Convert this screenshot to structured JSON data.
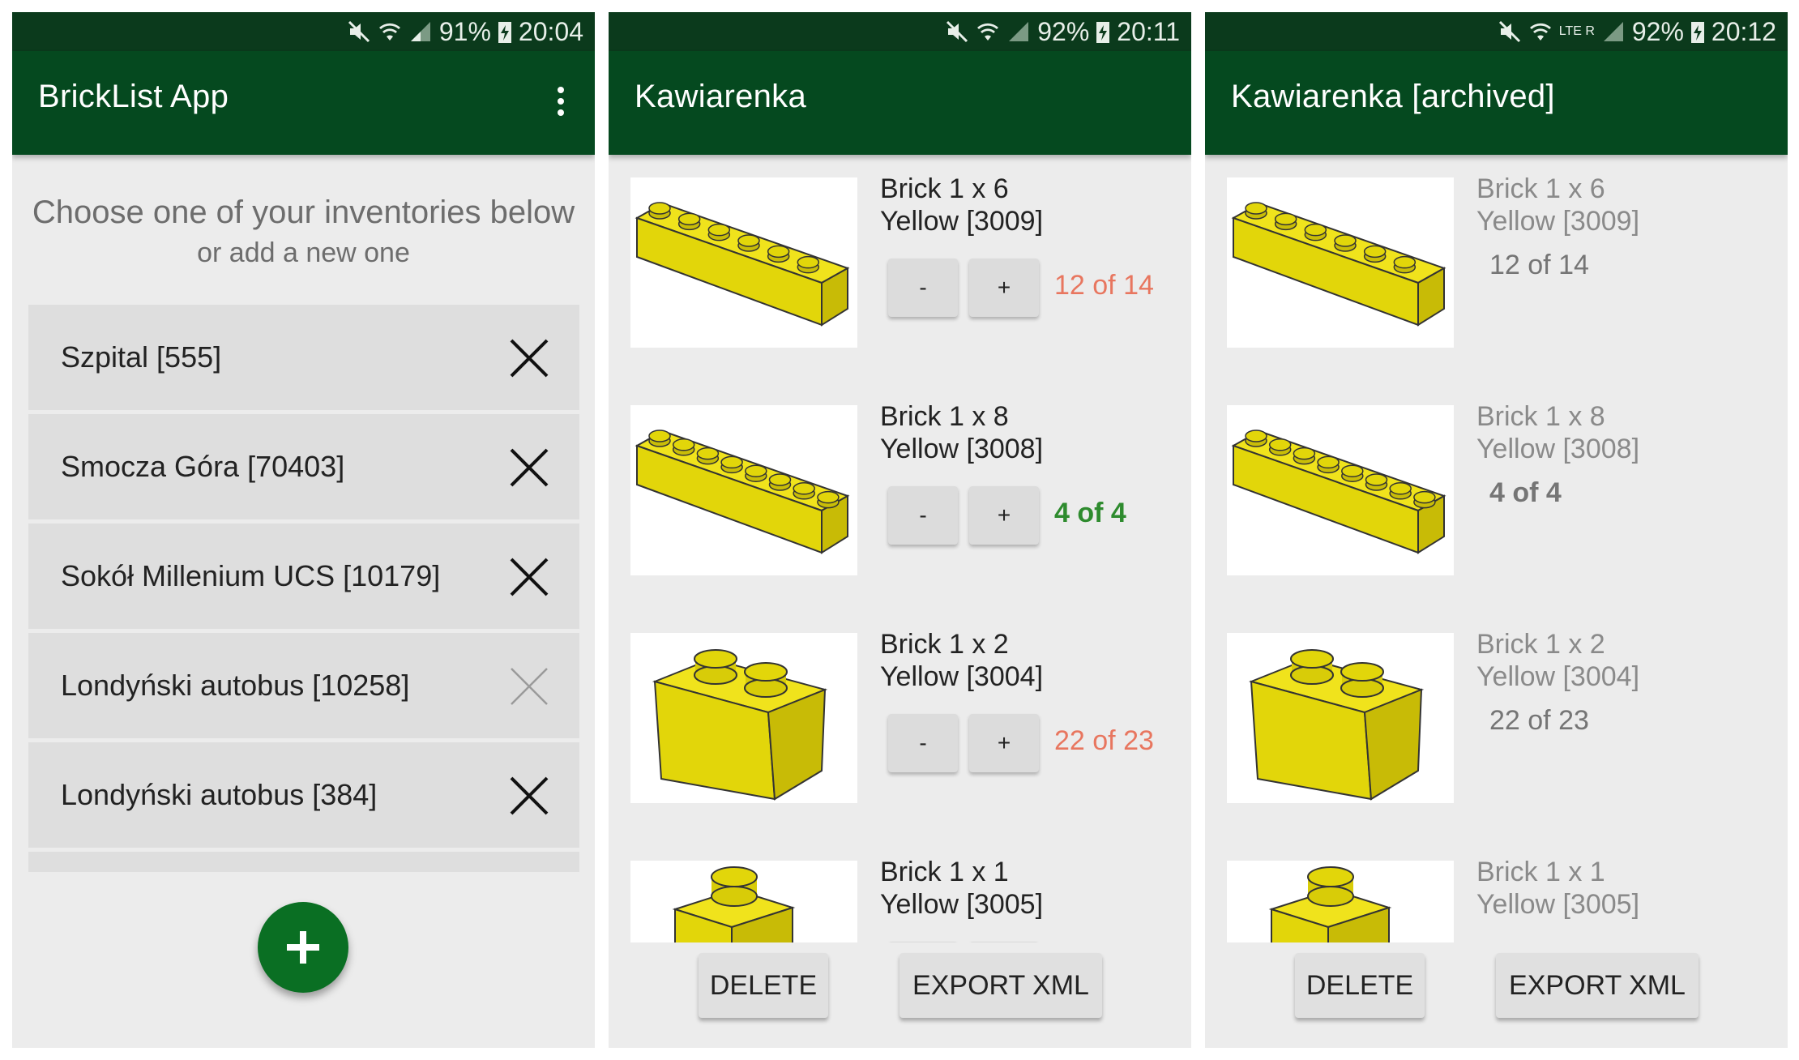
{
  "panel1": {
    "status": {
      "battery": "91%",
      "time": "20:04"
    },
    "title": "BrickList App",
    "menu_icon": "overflow-menu-icon",
    "choose_text": "Choose one of your inventories below",
    "choose_sub": "or add a new one",
    "inventories": [
      {
        "label": "Szpital [555]",
        "archived": false
      },
      {
        "label": "Smocza Góra [70403]",
        "archived": false
      },
      {
        "label": "Sokół Millenium UCS [10179]",
        "archived": false
      },
      {
        "label": "Londyński autobus [10258]",
        "archived": true
      },
      {
        "label": "Londyński autobus [384]",
        "archived": false
      }
    ],
    "fab_icon": "add-icon"
  },
  "panel2": {
    "status": {
      "battery": "92%",
      "time": "20:11"
    },
    "title": "Kawiarenka",
    "bricks": [
      {
        "name": "Brick 1 x 6",
        "color": "Yellow [3009]",
        "count": "12 of 14",
        "state": "incomplete",
        "shape": "1x6"
      },
      {
        "name": "Brick 1 x 8",
        "color": "Yellow [3008]",
        "count": "4 of 4",
        "state": "complete",
        "shape": "1x8"
      },
      {
        "name": "Brick 1 x 2",
        "color": "Yellow [3004]",
        "count": "22 of 23",
        "state": "incomplete",
        "shape": "1x2"
      },
      {
        "name": "Brick 1 x 1",
        "color": "Yellow [3005]",
        "count": "",
        "state": "incomplete",
        "shape": "1x1"
      }
    ],
    "minus_label": "-",
    "plus_label": "+",
    "delete_label": "DELETE",
    "export_label": "EXPORT XML"
  },
  "panel3": {
    "status": {
      "network": "LTE R",
      "battery": "92%",
      "time": "20:12"
    },
    "title": "Kawiarenka [archived]",
    "bricks": [
      {
        "name": "Brick 1 x 6",
        "color": "Yellow [3009]",
        "count": "12 of 14",
        "state": "incomplete",
        "shape": "1x6"
      },
      {
        "name": "Brick 1 x 8",
        "color": "Yellow [3008]",
        "count": "4 of 4",
        "state": "complete",
        "shape": "1x8"
      },
      {
        "name": "Brick 1 x 2",
        "color": "Yellow [3004]",
        "count": "22 of 23",
        "state": "incomplete",
        "shape": "1x2"
      },
      {
        "name": "Brick 1 x 1",
        "color": "Yellow [3005]",
        "count": "",
        "state": "incomplete",
        "shape": "1x1"
      }
    ],
    "delete_label": "DELETE",
    "export_label": "EXPORT XML"
  },
  "colors": {
    "app_bar": "#05491f",
    "status_bar": "#0b3a1c",
    "incomplete": "#e8765f",
    "complete": "#2e8b2e",
    "fab": "#0a6f23",
    "brick_yellow": "#e2d60a"
  }
}
